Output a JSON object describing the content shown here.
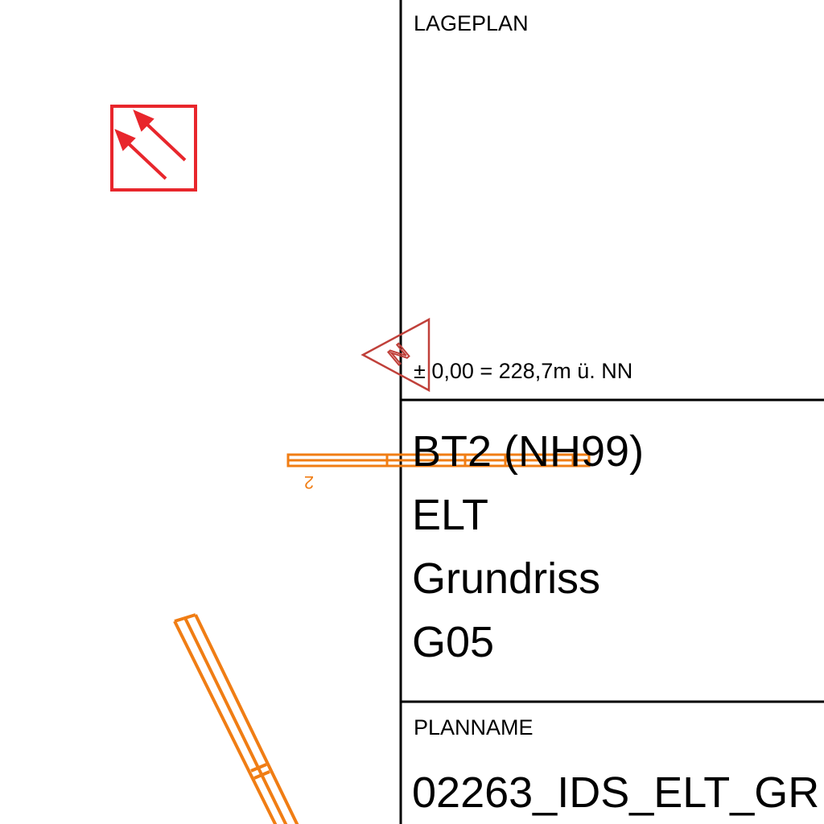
{
  "title_block": {
    "lageplan_label": "LAGEPLAN",
    "level_note": "± 0,00 = 228,7m ü. NN",
    "project_lines": [
      "BT2 (NH99)",
      "ELT",
      "Grundriss",
      "G05"
    ],
    "planname_label": "PLANNAME",
    "planname_value": "02263_IDS_ELT_GR"
  },
  "north_arrow": {
    "label": "N"
  },
  "drawing": {
    "duct_label": "2",
    "colors": {
      "frame": "#000000",
      "duct": "#f07d14",
      "symbol": "#e8262c",
      "north": "#c0403a"
    },
    "icons": [
      "escape-direction-sign-icon",
      "north-arrow-icon"
    ]
  }
}
